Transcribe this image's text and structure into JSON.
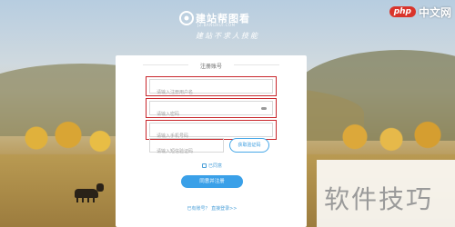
{
  "logo": {
    "title": "建站帮图看",
    "subtitle": "JZ.BANGHUI.COM",
    "slogan": "建站不求人技能"
  },
  "watermark_top": {
    "badge": "php",
    "text": "中文网"
  },
  "form": {
    "title": "注册账号",
    "username_placeholder": "请输入注册用户名",
    "password_placeholder": "请输入密码",
    "phone_placeholder": "请输入手机号码",
    "captcha_placeholder": "请输入短信验证码",
    "captcha_button": "获取验证码",
    "agree_label": "已同意",
    "register_button": "同意并注册",
    "login_link": "已有账号？ 直接登录>>"
  },
  "watermark_bottom": {
    "text": "软件技巧"
  },
  "colors": {
    "accent": "#3aa0e8",
    "highlight": "#c8262b"
  }
}
